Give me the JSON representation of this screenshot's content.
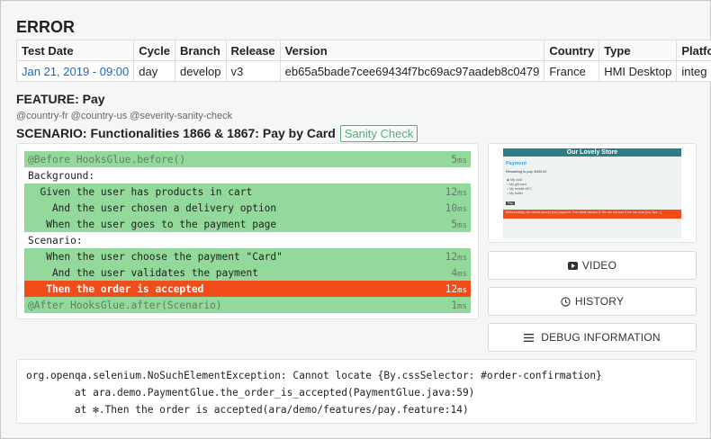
{
  "status_heading": "ERROR",
  "meta_table": {
    "headers": [
      "Test Date",
      "Cycle",
      "Branch",
      "Release",
      "Version",
      "Country",
      "Type",
      "Platform"
    ],
    "row": {
      "test_date": "Jan 21, 2019 - 09:00",
      "cycle": "day",
      "branch": "develop",
      "release": "v3",
      "version": "eb65a5bade7cee69434f7bc69ac97aadeb8c0479",
      "country": "France",
      "type": "HMI Desktop",
      "platform": "integ"
    }
  },
  "feature": {
    "title": "FEATURE: Pay",
    "tags": "@country-fr @country-us @severity-sanity-check"
  },
  "scenario": {
    "title": "SCENARIO: Functionalities 1866 & 1867: Pay by Card",
    "badge": "Sanity Check"
  },
  "steps": [
    {
      "text": "@Before HooksGlue.before()",
      "num": "5",
      "unit": "ms",
      "status": "hook"
    },
    {
      "text": "Background:",
      "num": "",
      "unit": "",
      "status": "plain"
    },
    {
      "text": "  Given the user has products in cart",
      "num": "12",
      "unit": "ms",
      "status": "ok"
    },
    {
      "text": "    And the user chosen a delivery option",
      "num": "10",
      "unit": "ms",
      "status": "ok"
    },
    {
      "text": "   When the user goes to the payment page",
      "num": "5",
      "unit": "ms",
      "status": "ok"
    },
    {
      "text": "Scenario:",
      "num": "",
      "unit": "",
      "status": "plain"
    },
    {
      "text": "   When the user choose the payment \"Card\"",
      "num": "12",
      "unit": "ms",
      "status": "ok"
    },
    {
      "text": "    And the user validates the payment",
      "num": "4",
      "unit": "ms",
      "status": "ok"
    },
    {
      "text": "   Then the order is accepted",
      "num": "12",
      "unit": "ms",
      "status": "fail"
    },
    {
      "text": "@After HooksGlue.after(Scenario)",
      "num": "1",
      "unit": "ms",
      "status": "hook"
    }
  ],
  "screenshot": {
    "store_name": "Our Lovely Store",
    "page_title": "Payment",
    "remaining": "Remaining to pay: $499.00",
    "options": [
      "My card",
      "My gift card",
      "My mobile NFC",
      "My butler"
    ],
    "pay_button": "Pay",
    "error_text": "Unfortunately, we cannot accept your payment. Your bank refused it. We are not sure if we can trust you. Bye :-("
  },
  "buttons": {
    "video": "VIDEO",
    "history": "HISTORY",
    "debug": "DEBUG INFORMATION"
  },
  "stacktrace": [
    "org.openqa.selenium.NoSuchElementException: Cannot locate {By.cssSelector: #order-confirmation}",
    "        at ara.demo.PaymentGlue.the_order_is_accepted(PaymentGlue.java:59)",
    "        at ✻.Then the order is accepted(ara/demo/features/pay.feature:14)"
  ],
  "colors": {
    "pass": "#93d99b",
    "fail": "#f24c1a",
    "badge": "#5ea87e",
    "link": "#1a66c8"
  },
  "icons": {
    "video": "video-icon",
    "history": "clock-icon",
    "debug": "menu-lines-icon"
  }
}
